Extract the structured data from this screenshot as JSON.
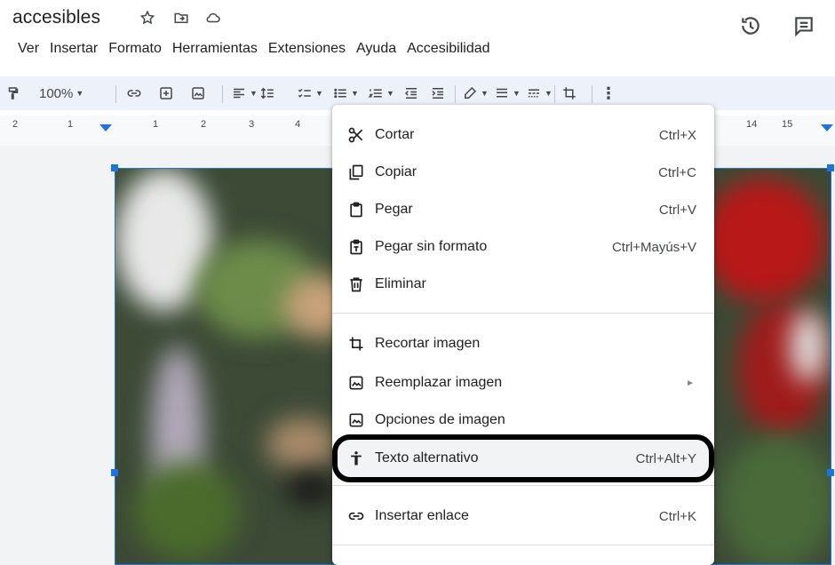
{
  "header": {
    "doc_title": "accesibles",
    "icons": [
      "star-icon",
      "move-to-folder-icon",
      "cloud-saved-icon",
      "version-history-icon",
      "comments-icon"
    ]
  },
  "menubar": {
    "items": [
      "Ver",
      "Insertar",
      "Formato",
      "Herramientas",
      "Extensiones",
      "Ayuda",
      "Accesibilidad"
    ]
  },
  "toolbar": {
    "zoom": "100%"
  },
  "ruler": {
    "left_numbers": [
      "2",
      "1",
      "1",
      "2",
      "3",
      "4"
    ],
    "right_numbers": [
      "14",
      "15"
    ]
  },
  "context_menu": {
    "items": [
      {
        "label": "Cortar",
        "shortcut": "Ctrl+X",
        "icon": "cut-icon"
      },
      {
        "label": "Copiar",
        "shortcut": "Ctrl+C",
        "icon": "copy-icon"
      },
      {
        "label": "Pegar",
        "shortcut": "Ctrl+V",
        "icon": "paste-icon"
      },
      {
        "label": "Pegar sin formato",
        "shortcut": "Ctrl+Mayús+V",
        "icon": "paste-plain-icon"
      },
      {
        "label": "Eliminar",
        "shortcut": "",
        "icon": "trash-icon"
      },
      {
        "label": "Recortar imagen",
        "shortcut": "",
        "icon": "crop-icon"
      },
      {
        "label": "Reemplazar imagen",
        "shortcut": "",
        "icon": "image-icon"
      },
      {
        "label": "Opciones de imagen",
        "shortcut": "",
        "icon": "image-icon"
      },
      {
        "label": "Texto alternativo",
        "shortcut": "Ctrl+Alt+Y",
        "icon": "accessibility-icon"
      },
      {
        "label": "Insertar enlace",
        "shortcut": "Ctrl+K",
        "icon": "link-icon"
      }
    ],
    "submenu_arrow": "►"
  },
  "colors": {
    "accent": "#1a73e8",
    "toolbar_bg": "#edf2fa",
    "highlight_ring": "#000000"
  }
}
